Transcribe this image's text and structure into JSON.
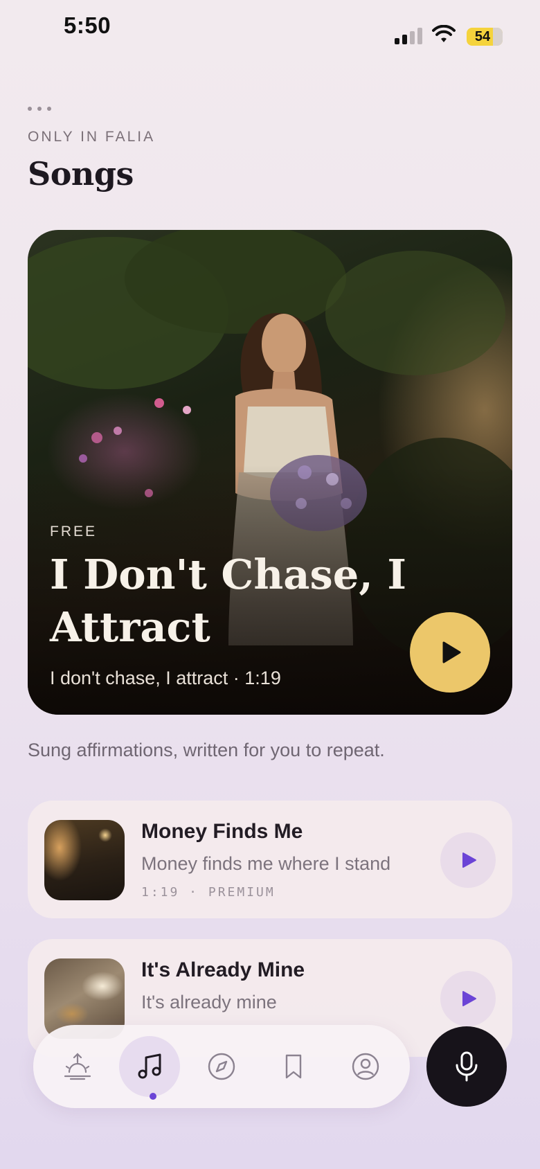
{
  "status_bar": {
    "time": "5:50",
    "battery": "54"
  },
  "header": {
    "eyebrow": "ONLY IN FALIA",
    "title": "Songs"
  },
  "featured": {
    "tag": "FREE",
    "title": "I Don't Chase, I Attract",
    "subtitle": "I don't chase, I attract · 1:19",
    "play_icon": "play-icon"
  },
  "intro_text": "Sung affirmations, written for you to repeat.",
  "songs": [
    {
      "title": "Money Finds Me",
      "subtitle": "Money finds me where I stand",
      "meta": "1:19 · PREMIUM"
    },
    {
      "title": "It's Already Mine",
      "subtitle": "It's already mine",
      "meta": ""
    }
  ],
  "nav": {
    "items": [
      "sunrise-icon",
      "music-note-icon",
      "compass-icon",
      "bookmark-icon",
      "profile-icon"
    ],
    "active_index": 1,
    "mic_icon": "microphone-icon"
  },
  "colors": {
    "accent": "#6b44d6",
    "play_gold": "#ecc76a",
    "mic_dark": "#17131a"
  }
}
